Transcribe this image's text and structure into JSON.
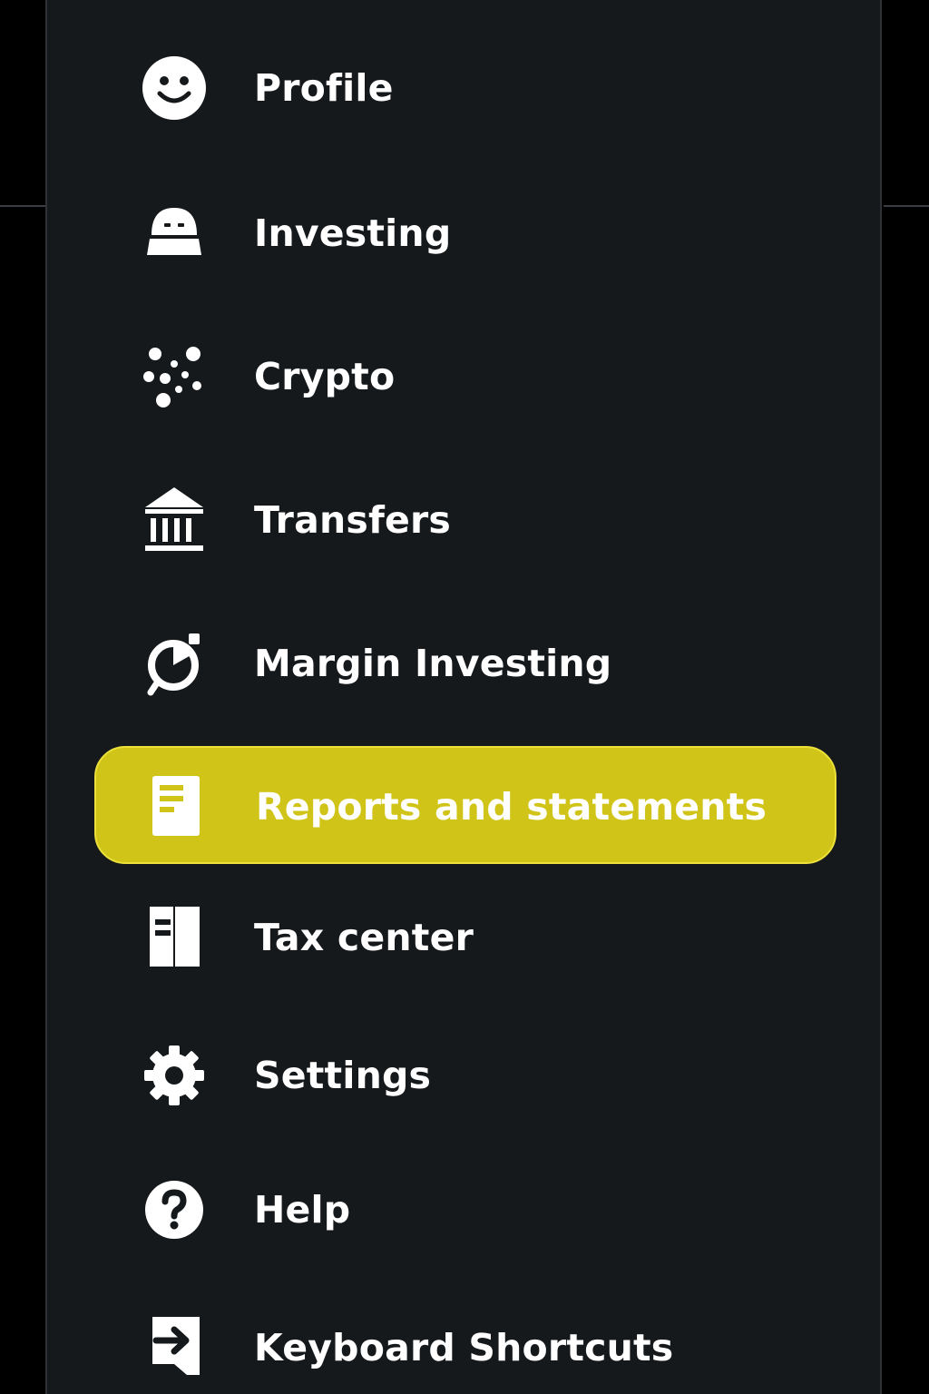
{
  "theme": {
    "background": "#000000",
    "panel": "#16191c",
    "text": "#ffffff",
    "highlight": "#d1c418"
  },
  "menu": {
    "items": [
      {
        "label": "Profile",
        "icon": "smiley-face-icon",
        "active": false
      },
      {
        "label": "Investing",
        "icon": "investing-robot-icon",
        "active": false
      },
      {
        "label": "Crypto",
        "icon": "crypto-network-icon",
        "active": false
      },
      {
        "label": "Transfers",
        "icon": "bank-icon",
        "active": false
      },
      {
        "label": "Margin Investing",
        "icon": "margin-gauge-icon",
        "active": false
      },
      {
        "label": "Reports and statements",
        "icon": "document-icon",
        "active": true
      },
      {
        "label": "Tax center",
        "icon": "tax-book-icon",
        "active": false
      },
      {
        "label": "Settings",
        "icon": "gear-icon",
        "active": false
      },
      {
        "label": "Help",
        "icon": "question-circle-icon",
        "active": false
      },
      {
        "label": "Keyboard Shortcuts",
        "icon": "arrow-right-box-icon",
        "active": false
      }
    ]
  }
}
